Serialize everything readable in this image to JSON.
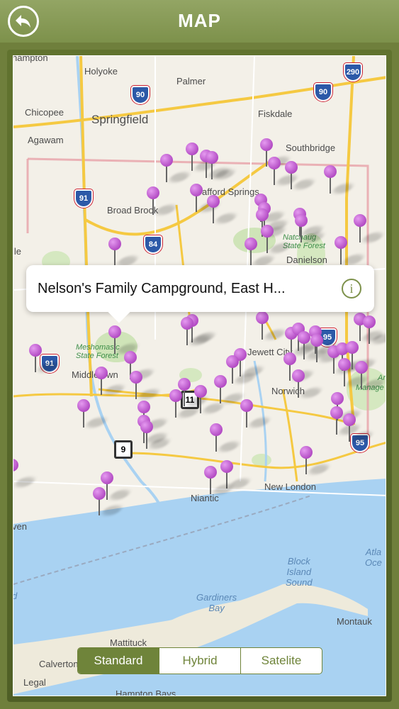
{
  "header": {
    "title": "MAP",
    "back_icon": "back-arrow-icon"
  },
  "callout": {
    "text": "Nelson's Family Campground, East H...",
    "info_glyph": "i"
  },
  "map_type": {
    "options": [
      "Standard",
      "Hybrid",
      "Satelite"
    ],
    "selected": "Standard"
  },
  "places": {
    "northampton": "hampton",
    "holyoke": "Holyoke",
    "palmer": "Palmer",
    "chicopee": "Chicopee",
    "springfield": "Springfield",
    "fiskdale": "Fiskdale",
    "agawam": "Agawam",
    "southbridge": "Southbridge",
    "stafford": "afford Springs",
    "broad_brook": "Broad Brook",
    "natchaug": "Natchaug\nState Forest",
    "danielson": "Danielson",
    "ile": "lle",
    "meshomasic": "Meshomasic\nState Forest",
    "middletown": "Middletown",
    "jewett": "Jewett City",
    "norwich": "Norwich",
    "manage": "Manage",
    "ar": "Ar",
    "new_london": "New London",
    "niantic": "Niantic",
    "haven": "ven",
    "atlantic": "Atla\nOce",
    "block_island": "Block\nIsland\nSound",
    "gardiners": "Gardiners\nBay",
    "montauk": "Montauk",
    "mattituck": "Mattituck",
    "calverton": "Calverton",
    "legal": "Legal",
    "hampton_bays": "Hampton Bays",
    "d": "d"
  },
  "shields": {
    "i290": "290",
    "i90a": "90",
    "i90b": "90",
    "i91a": "91",
    "i84": "84",
    "i91b": "91",
    "i95a": "95",
    "i95b": "95",
    "r9": "9",
    "r11": "11"
  },
  "colors": {
    "header": "#7d914b",
    "pin": "#c05ad0",
    "accent": "#6f843a"
  }
}
